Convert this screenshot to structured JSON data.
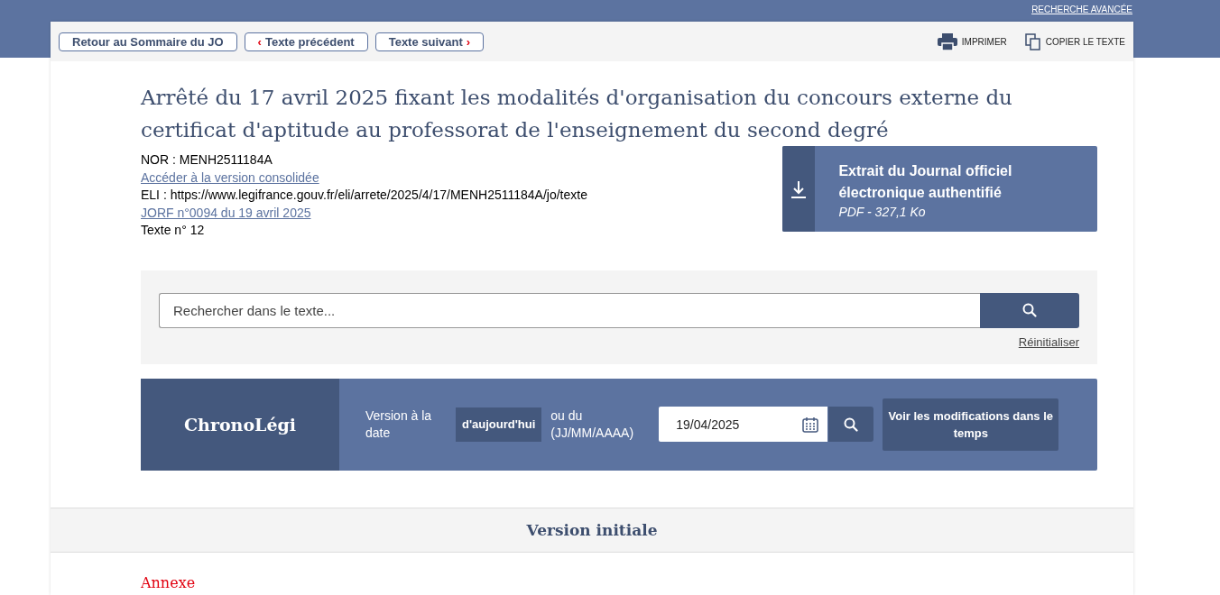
{
  "header": {
    "advanced_search_link": "RECHERCHE AVANCÉE"
  },
  "toolbar": {
    "nav_buttons": [
      {
        "kind": "plain",
        "label": "Retour au Sommaire du JO"
      },
      {
        "kind": "prev",
        "label": "Texte précédent",
        "chevron": "‹"
      },
      {
        "kind": "next",
        "label": "Texte suivant",
        "chevron": "›"
      }
    ],
    "actions": [
      {
        "kind": "print",
        "label": "IMPRIMER"
      },
      {
        "kind": "copy",
        "label": "COPIER LE TEXTE"
      }
    ]
  },
  "document": {
    "title": "Arrêté du 17 avril 2025 fixant les modalités d'organisation du concours externe du certificat d'aptitude au professorat de l'enseignement du second degré",
    "meta": [
      {
        "kind": "text",
        "text": "NOR : MENH2511184A"
      },
      {
        "kind": "link",
        "text": "Accéder à la version consolidée"
      },
      {
        "kind": "text",
        "text": "ELI : https://www.legifrance.gouv.fr/eli/arrete/2025/4/17/MENH2511184A/jo/texte"
      },
      {
        "kind": "link",
        "text": "JORF n°0094 du 19 avril 2025"
      },
      {
        "kind": "text",
        "text": "Texte n° 12"
      }
    ]
  },
  "download": {
    "title": "Extrait du Journal officiel électronique authentifié",
    "subtitle": "PDF - 327,1 Ko"
  },
  "search": {
    "placeholder": "Rechercher dans le texte...",
    "reset_link": "Réinitialiser"
  },
  "chronolegi": {
    "title": "ChronoLégi",
    "version_label": "Version à la date",
    "today_button": "d'aujourd'hui",
    "date_label": "ou du (JJ/MM/AAAA)",
    "date_value": "19/04/2025",
    "changes_button": "Voir les modifications dans le temps"
  },
  "version_heading": "Version initiale",
  "section_title": "Annexe"
}
